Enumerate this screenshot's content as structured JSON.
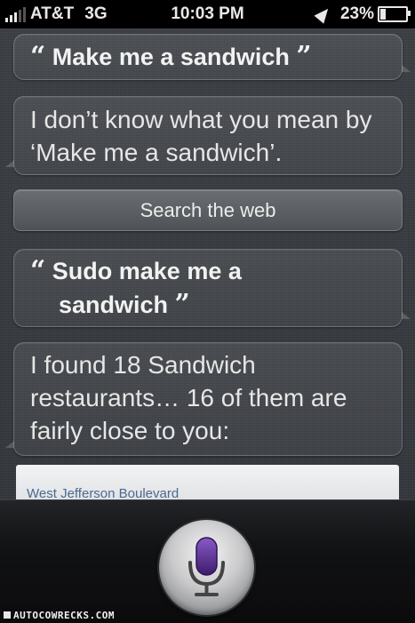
{
  "status_bar": {
    "signal_bars": 5,
    "signal_active": 3,
    "carrier": "AT&T",
    "network": "3G",
    "time": "10:03 PM",
    "battery_percent": "23%",
    "battery_level": 0.23
  },
  "conversation": {
    "user_1": {
      "open_quote": "“",
      "text": "Make me a sandwich",
      "close_quote": "”"
    },
    "siri_1": {
      "line1": "I don’t know what you mean by",
      "line2": "‘Make me a sandwich’."
    },
    "search_button": "Search the web",
    "user_2": {
      "open_quote": "“",
      "line1": "Sudo make me a",
      "line2": "sandwich",
      "close_quote": "”"
    },
    "siri_2": {
      "line1": "I found 18 Sandwich",
      "line2": "restaurants… 16 of them are",
      "line3": "fairly close to you:"
    },
    "result_card": {
      "address": "West Jefferson Boulevard"
    }
  },
  "footer": {
    "mic_icon": "microphone-icon",
    "watermark": "AUTOCOWRECKS.COM"
  },
  "colors": {
    "background": "#3a3d42",
    "mic_accent": "#5a2d8f",
    "text": "#f2f2f2"
  }
}
